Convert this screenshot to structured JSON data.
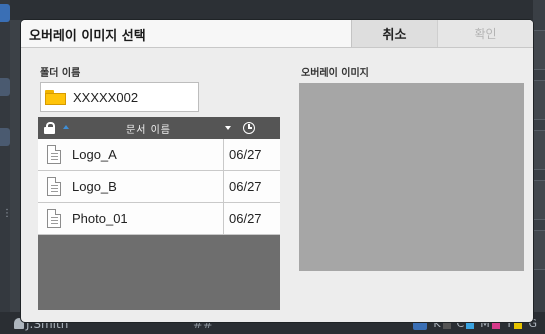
{
  "background": {
    "user": "J.Smith",
    "center_text": "##",
    "toners": [
      {
        "label": "K",
        "color": "#555555"
      },
      {
        "label": "C",
        "color": "#3aa3e0"
      },
      {
        "label": "M",
        "color": "#d63a8a"
      },
      {
        "label": "Y",
        "color": "#e6c300"
      },
      {
        "label": "G",
        "color": "#7a7a7a"
      }
    ]
  },
  "dialog": {
    "title": "오버레이 이미지 선택",
    "cancel_label": "취소",
    "confirm_label": "확인",
    "folder_label": "폴더 이름",
    "folder_name": "XXXXX002",
    "list_header": {
      "name_col": "문서 이름",
      "icons": [
        "lock-icon",
        "sort-ascending-icon",
        "sort-dropdown-icon",
        "clock-icon"
      ]
    },
    "files": [
      {
        "name": "Logo_A",
        "date": "06/27"
      },
      {
        "name": "Logo_B",
        "date": "06/27"
      },
      {
        "name": "Photo_01",
        "date": "06/27"
      }
    ],
    "preview_label": "오버레이 이미지"
  }
}
